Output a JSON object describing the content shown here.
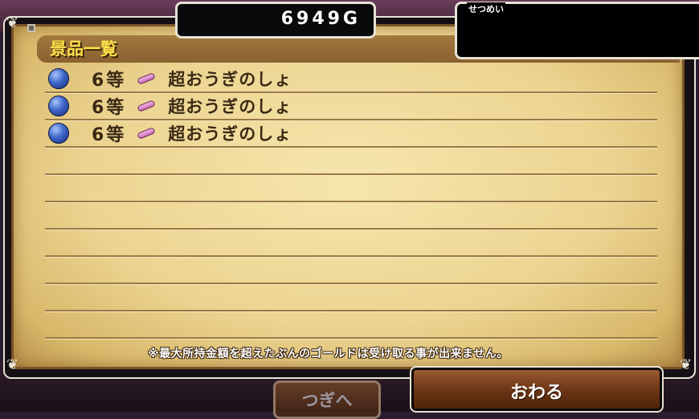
{
  "currency": {
    "gold": "6949G"
  },
  "description_panel": {
    "label": "せつめい"
  },
  "prize_list": {
    "title": "景品一覧",
    "items": [
      {
        "rank": "6等",
        "icon": "scroll-icon",
        "name": "超おうぎのしょ"
      },
      {
        "rank": "6等",
        "icon": "scroll-icon",
        "name": "超おうぎのしょ"
      },
      {
        "rank": "6等",
        "icon": "scroll-icon",
        "name": "超おうぎのしょ"
      }
    ],
    "notice": "※最大所持金額を超えたぶんのゴールドは受け取る事が出来ません。"
  },
  "buttons": {
    "next": "つぎへ",
    "end": "おわる"
  },
  "colors": {
    "title": "#ffe14a",
    "parchment": "#ecd491",
    "orb": "#3e66c8",
    "scroll": "#c868b8"
  }
}
